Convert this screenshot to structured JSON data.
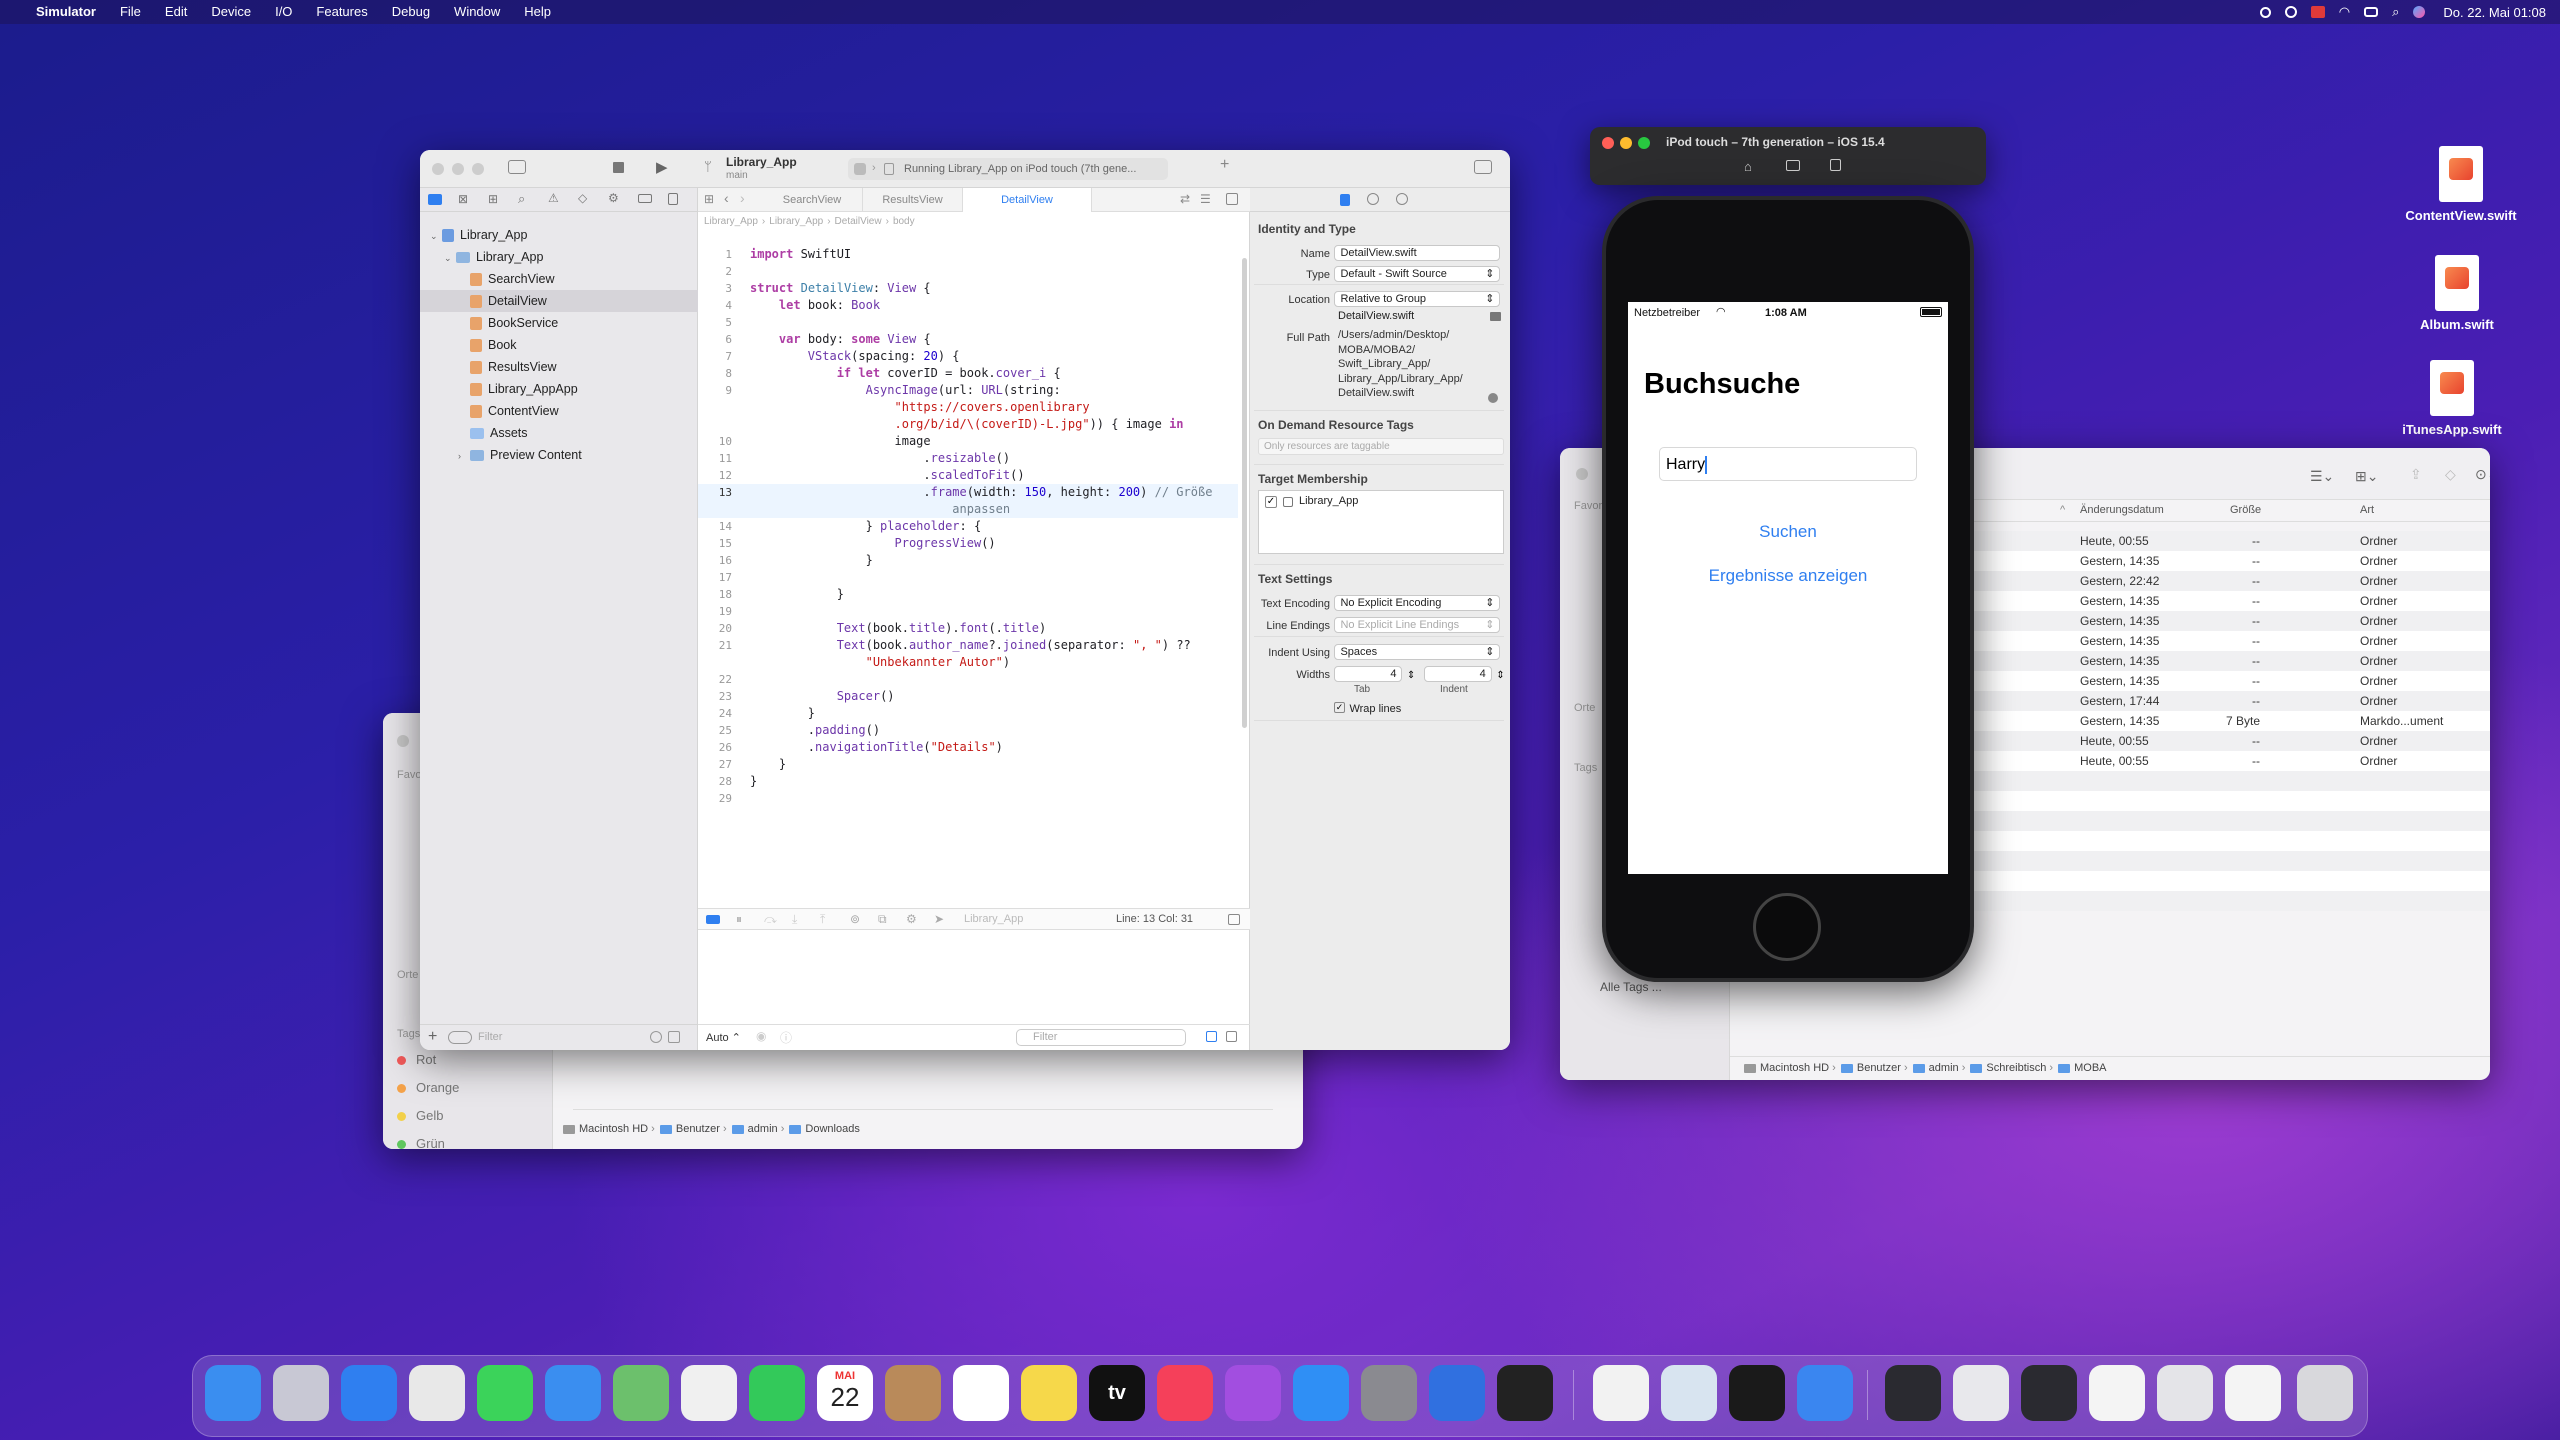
{
  "menubar": {
    "apple": "",
    "app": "Simulator",
    "items": [
      "File",
      "Edit",
      "Device",
      "I/O",
      "Features",
      "Debug",
      "Window",
      "Help"
    ],
    "clock": "Do. 22. Mai  01:08"
  },
  "xcode": {
    "project": "Library_App",
    "branch": "main",
    "status": "Running Library_App on iPod touch (7th gene...",
    "tabs": [
      "SearchView",
      "ResultsView",
      "DetailView"
    ],
    "jumpbar": [
      "Library_App",
      "Library_App",
      "DetailView",
      "body"
    ],
    "tree": [
      {
        "label": "Library_App",
        "kind": "project",
        "indent": 0
      },
      {
        "label": "Library_App",
        "kind": "folder",
        "indent": 1
      },
      {
        "label": "SearchView",
        "kind": "file",
        "indent": 2
      },
      {
        "label": "DetailView",
        "kind": "file",
        "indent": 2,
        "selected": true
      },
      {
        "label": "BookService",
        "kind": "file",
        "indent": 2
      },
      {
        "label": "Book",
        "kind": "file",
        "indent": 2
      },
      {
        "label": "ResultsView",
        "kind": "file",
        "indent": 2
      },
      {
        "label": "Library_AppApp",
        "kind": "file",
        "indent": 2
      },
      {
        "label": "ContentView",
        "kind": "file",
        "indent": 2
      },
      {
        "label": "Assets",
        "kind": "assets",
        "indent": 2
      },
      {
        "label": "Preview Content",
        "kind": "folder",
        "indent": 2
      }
    ],
    "filter_placeholder": "Filter",
    "code": [
      {
        "n": "1",
        "html": "<span class='kw'>import</span> SwiftUI"
      },
      {
        "n": "2",
        "html": ""
      },
      {
        "n": "3",
        "html": "<span class='kw'>struct</span> <span class='ty'>DetailView</span>: <span class='fn'>View</span> {"
      },
      {
        "n": "4",
        "html": "    <span class='kw'>let</span> book: <span class='fn'>Book</span>"
      },
      {
        "n": "5",
        "html": ""
      },
      {
        "n": "6",
        "html": "    <span class='kw'>var</span> body: <span class='kw'>some</span> <span class='fn'>View</span> {"
      },
      {
        "n": "7",
        "html": "        <span class='fn'>VStack</span>(spacing: <span class='nm'>20</span>) {"
      },
      {
        "n": "8",
        "html": "            <span class='kw'>if let</span> coverID = book.<span class='fn'>cover_i</span> {"
      },
      {
        "n": "9",
        "html": "                <span class='fn'>AsyncImage</span>(url: <span class='fn'>URL</span>(string:"
      },
      {
        "n": "",
        "html": "                    <span class='st'>\"https://covers.openlibrary</span>"
      },
      {
        "n": "",
        "html": "                    <span class='st'>.org/b/id/\\(coverID)-L.jpg\"</span>)) { image <span class='kw'>in</span>"
      },
      {
        "n": "10",
        "html": "                    image"
      },
      {
        "n": "11",
        "html": "                        .<span class='fn'>resizable</span>()"
      },
      {
        "n": "12",
        "html": "                        .<span class='fn'>scaledToFit</span>()"
      },
      {
        "n": "13",
        "html": "                        .<span class='fn'>frame</span>(width: <span class='nm'>150</span>, height: <span class='nm'>200</span>) <span class='cm'>// Größe</span>",
        "hl": true
      },
      {
        "n": "",
        "html": "                            <span class='cm'>anpassen</span>",
        "hl": true
      },
      {
        "n": "14",
        "html": "                } <span class='fn'>placeholder</span>: {"
      },
      {
        "n": "15",
        "html": "                    <span class='fn'>ProgressView</span>()"
      },
      {
        "n": "16",
        "html": "                }"
      },
      {
        "n": "17",
        "html": ""
      },
      {
        "n": "18",
        "html": "            }"
      },
      {
        "n": "19",
        "html": ""
      },
      {
        "n": "20",
        "html": "            <span class='fn'>Text</span>(book.<span class='fn'>title</span>).<span class='fn'>font</span>(.<span class='fn'>title</span>)"
      },
      {
        "n": "21",
        "html": "            <span class='fn'>Text</span>(book.<span class='fn'>author_name</span>?.<span class='fn'>joined</span>(separator: <span class='st'>\", \"</span>) ??"
      },
      {
        "n": "",
        "html": "                <span class='st'>\"Unbekannter Autor\"</span>)"
      },
      {
        "n": "22",
        "html": ""
      },
      {
        "n": "23",
        "html": "            <span class='fn'>Spacer</span>()"
      },
      {
        "n": "24",
        "html": "        }"
      },
      {
        "n": "25",
        "html": "        .<span class='fn'>padding</span>()"
      },
      {
        "n": "26",
        "html": "        .<span class='fn'>navigationTitle</span>(<span class='st'>\"Details\"</span>)"
      },
      {
        "n": "27",
        "html": "    }"
      },
      {
        "n": "28",
        "html": "}"
      },
      {
        "n": "29",
        "html": ""
      }
    ],
    "debugbar": {
      "target": "Library_App",
      "cursor": "Line: 13  Col: 31"
    },
    "console": {
      "mode": "Auto ⌃",
      "filter": "Filter"
    },
    "inspector": {
      "identity_title": "Identity and Type",
      "name_label": "Name",
      "name_value": "DetailView.swift",
      "type_label": "Type",
      "type_value": "Default - Swift Source",
      "location_label": "Location",
      "location_value": "Relative to Group",
      "location_file": "DetailView.swift",
      "fullpath_label": "Full Path",
      "fullpath": [
        "/Users/admin/Desktop/",
        "MOBA/MOBA2/",
        "Swift_Library_App/",
        "Library_App/Library_App/",
        "DetailView.swift"
      ],
      "odr_title": "On Demand Resource Tags",
      "odr_placeholder": "Only resources are taggable",
      "target_title": "Target Membership",
      "target_item": "Library_App",
      "text_title": "Text Settings",
      "enc_label": "Text Encoding",
      "enc_value": "No Explicit Encoding",
      "le_label": "Line Endings",
      "le_value": "No Explicit Line Endings",
      "indent_label": "Indent Using",
      "indent_value": "Spaces",
      "widths_label": "Widths",
      "tab_value": "4",
      "indent_num": "4",
      "tab_label": "Tab",
      "indent_lbl": "Indent",
      "wrap_label": "Wrap lines"
    }
  },
  "finder_left": {
    "sidebar": [
      "Favoriten",
      "Orte",
      "Tags"
    ],
    "tags": [
      "Rot",
      "Orange",
      "Gelb",
      "Grün"
    ],
    "tag_colors": [
      "#f25a5a",
      "#f5a34a",
      "#f2d04a",
      "#5fc65f"
    ],
    "path": [
      "Macintosh HD",
      "Benutzer",
      "admin",
      "Downloads"
    ]
  },
  "finder_right": {
    "headers": [
      "Änderungsdatum",
      "Größe",
      "Art"
    ],
    "rows": [
      [
        "Heute, 00:55",
        "--",
        "Ordner"
      ],
      [
        "Gestern, 14:35",
        "--",
        "Ordner"
      ],
      [
        "Gestern, 22:42",
        "--",
        "Ordner"
      ],
      [
        "Gestern, 14:35",
        "--",
        "Ordner"
      ],
      [
        "Gestern, 14:35",
        "--",
        "Ordner"
      ],
      [
        "Gestern, 14:35",
        "--",
        "Ordner"
      ],
      [
        "Gestern, 14:35",
        "--",
        "Ordner"
      ],
      [
        "Gestern, 14:35",
        "--",
        "Ordner"
      ],
      [
        "Gestern, 17:44",
        "--",
        "Ordner"
      ],
      [
        "Gestern, 14:35",
        "7 Byte",
        "Markdo...ument"
      ],
      [
        "Heute, 00:55",
        "--",
        "Ordner"
      ],
      [
        "Heute, 00:55",
        "--",
        "Ordner"
      ]
    ],
    "sidebar": [
      "Favoriten",
      "Orte",
      "Tags",
      "Alle Tags ..."
    ],
    "path": [
      "Macintosh HD",
      "Benutzer",
      "admin",
      "Schreibtisch",
      "MOBA"
    ]
  },
  "simulator": {
    "title": "iPod touch – 7th generation – iOS 15.4",
    "carrier": "Netzbetreiber",
    "time": "1:08 AM",
    "heading": "Buchsuche",
    "search_value": "Harry",
    "search_button": "Suchen",
    "results_button": "Ergebnisse anzeigen"
  },
  "desktop_files": [
    "ContentView.swift",
    "Album.swift",
    "iTunesApp.swift"
  ],
  "dock": {
    "calendar_month": "MAI",
    "calendar_day": "22",
    "tv_label": "tv",
    "apps": [
      {
        "name": "finder",
        "color": "#3a8ef0"
      },
      {
        "name": "launchpad",
        "color": "#c8c8d4"
      },
      {
        "name": "safari",
        "color": "#2f7ff0"
      },
      {
        "name": "chrome",
        "color": "#e8e8e8"
      },
      {
        "name": "messages",
        "color": "#3bd35a"
      },
      {
        "name": "mail",
        "color": "#3a8ef0"
      },
      {
        "name": "maps",
        "color": "#6cc06c"
      },
      {
        "name": "photos",
        "color": "#f0f0f0"
      },
      {
        "name": "facetime",
        "color": "#33c95a"
      },
      {
        "name": "calendar",
        "color": "#ffffff"
      },
      {
        "name": "contacts",
        "color": "#b98a5a"
      },
      {
        "name": "reminders",
        "color": "#ffffff"
      },
      {
        "name": "notes",
        "color": "#f6d84a"
      },
      {
        "name": "tv",
        "color": "#111111"
      },
      {
        "name": "music",
        "color": "#f5405a"
      },
      {
        "name": "podcasts",
        "color": "#a24ee0"
      },
      {
        "name": "app-store",
        "color": "#2f8ff5"
      },
      {
        "name": "system-preferences",
        "color": "#8a8a90"
      },
      {
        "name": "xcode",
        "color": "#3070e0"
      },
      {
        "name": "activity-monitor",
        "color": "#222222"
      },
      {
        "name": "textedit",
        "color": "#f2f2f2"
      },
      {
        "name": "preview",
        "color": "#d8e4f0"
      },
      {
        "name": "terminal",
        "color": "#1a1a1a"
      },
      {
        "name": "simulator",
        "color": "#3a86f0"
      },
      {
        "name": "window-1",
        "color": "#2a2a30"
      },
      {
        "name": "window-2",
        "color": "#e8e8ec"
      },
      {
        "name": "window-3",
        "color": "#2a2a30"
      },
      {
        "name": "window-4",
        "color": "#f4f4f4"
      },
      {
        "name": "window-5",
        "color": "#e4e4e8"
      },
      {
        "name": "window-6",
        "color": "#f4f4f4"
      },
      {
        "name": "trash",
        "color": "#d8d8dc"
      }
    ]
  }
}
